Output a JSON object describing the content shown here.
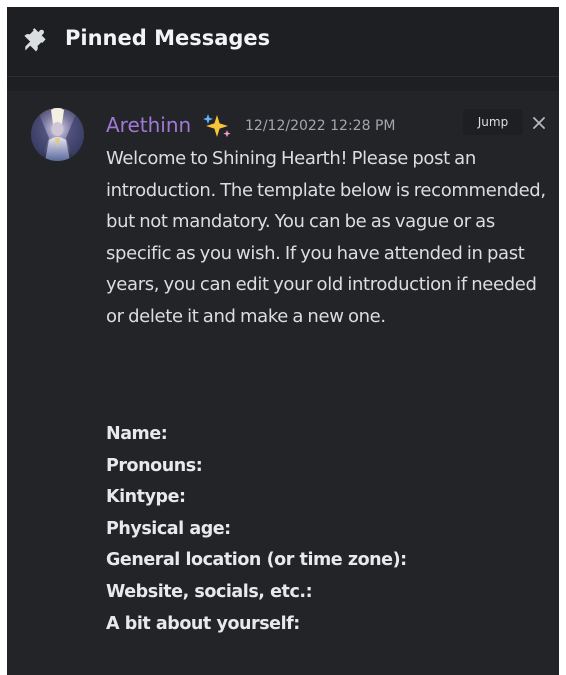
{
  "header": {
    "icon": "pin-icon",
    "title": "Pinned Messages"
  },
  "message": {
    "author": "Arethinn",
    "author_color": "#a079d6",
    "author_badge_icon": "sparkles-icon",
    "timestamp": "12/12/2022 12:28 PM",
    "jump_label": "Jump",
    "close_icon": "close-icon",
    "body": "Welcome to Shining Hearth! Please post an introduction. The template below is recommended, but not mandatory. You can be as vague or as specific as you wish. If you have attended in past years, you can edit your old introduction if needed or delete it and make a new one.",
    "template_fields": [
      "Name:",
      "Pronouns:",
      "Kintype:",
      "Physical age:",
      "General location (or time zone):",
      "Website, socials, etc.:",
      "A bit about yourself:"
    ]
  },
  "colors": {
    "background": "#1e1f22",
    "card": "#232428",
    "text": "#dbdee1",
    "muted": "#a3a6ad"
  }
}
